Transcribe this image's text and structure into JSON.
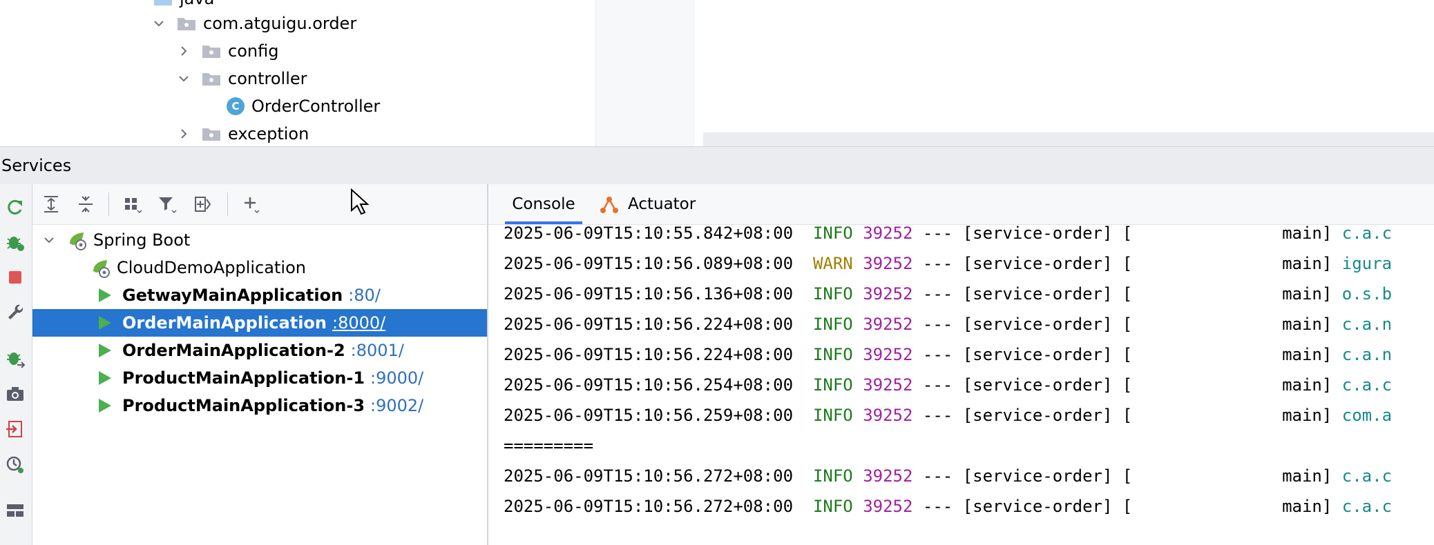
{
  "project_tree": {
    "rows": [
      {
        "label": "java",
        "indent": 0,
        "chevron": "none",
        "icon": "folder-icon"
      },
      {
        "label": "com.atguigu.order",
        "indent": 1,
        "chevron": "down",
        "icon": "package-icon"
      },
      {
        "label": "config",
        "indent": 2,
        "chevron": "right",
        "icon": "package-icon"
      },
      {
        "label": "controller",
        "indent": 2,
        "chevron": "down",
        "icon": "package-icon"
      },
      {
        "label": "OrderController",
        "indent": 3,
        "chevron": "none",
        "icon": "class-icon"
      },
      {
        "label": "exception",
        "indent": 2,
        "chevron": "right",
        "icon": "package-icon"
      }
    ],
    "class_icon_letter": "C"
  },
  "services": {
    "title": "Services",
    "tree": {
      "group_label": "Spring Boot",
      "items": [
        {
          "name": "CloudDemoApplication",
          "port": "",
          "bold": false,
          "running": false,
          "selected": false
        },
        {
          "name": "GetwayMainApplication",
          "port": ":80/",
          "bold": true,
          "running": true,
          "selected": false
        },
        {
          "name": "OrderMainApplication",
          "port": ":8000/",
          "bold": true,
          "running": true,
          "selected": true
        },
        {
          "name": "OrderMainApplication-2",
          "port": ":8001/",
          "bold": true,
          "running": true,
          "selected": false
        },
        {
          "name": "ProductMainApplication-1",
          "port": ":9000/",
          "bold": true,
          "running": true,
          "selected": false
        },
        {
          "name": "ProductMainApplication-3",
          "port": ":9002/",
          "bold": true,
          "running": true,
          "selected": false
        }
      ]
    },
    "console_tabs": [
      {
        "label": "Console",
        "active": true
      },
      {
        "label": "Actuator",
        "active": false
      }
    ],
    "log_lines": [
      {
        "timestamp": "2025-06-09T15:10:55.842+08:00",
        "level": "INFO",
        "pid": "39252",
        "sep": " --- ",
        "app": "[service-order] [",
        "thread": "               main] ",
        "logger": "c.a.c"
      },
      {
        "timestamp": "2025-06-09T15:10:56.089+08:00",
        "level": "WARN",
        "pid": "39252",
        "sep": " --- ",
        "app": "[service-order] [",
        "thread": "               main] ",
        "logger": "igura"
      },
      {
        "timestamp": "2025-06-09T15:10:56.136+08:00",
        "level": "INFO",
        "pid": "39252",
        "sep": " --- ",
        "app": "[service-order] [",
        "thread": "               main] ",
        "logger": "o.s.b"
      },
      {
        "timestamp": "2025-06-09T15:10:56.224+08:00",
        "level": "INFO",
        "pid": "39252",
        "sep": " --- ",
        "app": "[service-order] [",
        "thread": "               main] ",
        "logger": "c.a.n"
      },
      {
        "timestamp": "2025-06-09T15:10:56.224+08:00",
        "level": "INFO",
        "pid": "39252",
        "sep": " --- ",
        "app": "[service-order] [",
        "thread": "               main] ",
        "logger": "c.a.n"
      },
      {
        "timestamp": "2025-06-09T15:10:56.254+08:00",
        "level": "INFO",
        "pid": "39252",
        "sep": " --- ",
        "app": "[service-order] [",
        "thread": "               main] ",
        "logger": "c.a.c"
      },
      {
        "timestamp": "2025-06-09T15:10:56.259+08:00",
        "level": "INFO",
        "pid": "39252",
        "sep": " --- ",
        "app": "[service-order] [",
        "thread": "               main] ",
        "logger": "com.a"
      },
      {
        "plain": "========="
      },
      {
        "timestamp": "2025-06-09T15:10:56.272+08:00",
        "level": "INFO",
        "pid": "39252",
        "sep": " --- ",
        "app": "[service-order] [",
        "thread": "               main] ",
        "logger": "c.a.c"
      },
      {
        "timestamp": "2025-06-09T15:10:56.272+08:00",
        "level": "INFO",
        "pid": "39252",
        "sep": " --- ",
        "app": "[service-order] [",
        "thread": "               main] ",
        "logger": "c.a.c"
      }
    ]
  },
  "icons": {
    "tree_toolbar": [
      "expand-all-icon",
      "collapse-all-icon",
      "group-by-icon",
      "filter-icon",
      "new-service-icon",
      "add-service-icon"
    ],
    "left_toolbar": [
      "rerun-icon",
      "debug-icon",
      "stop-icon",
      "settings-wrench-icon",
      "debug-attach-icon",
      "screenshot-camera-icon",
      "sign-in-icon",
      "profiler-icon",
      "layout-icon"
    ]
  },
  "colors": {
    "selection": "#2675cf",
    "info": "#1b7a1b",
    "warn": "#a08000",
    "pid": "#a020a0",
    "logger": "#178a8a",
    "spring": "#6db33f",
    "run": "#4caf50",
    "stop": "#e05555"
  }
}
